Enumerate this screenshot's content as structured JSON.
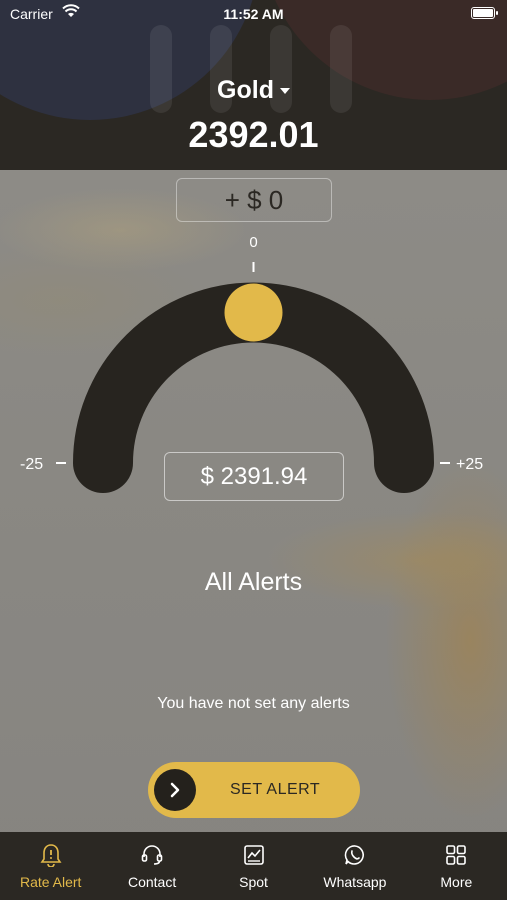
{
  "status_bar": {
    "carrier": "Carrier",
    "time": "11:52 AM"
  },
  "header": {
    "metal": "Gold",
    "price": "2392.01"
  },
  "dial": {
    "offset": "+ $ 0",
    "center_label": "0",
    "min_label": "-25",
    "max_label": "+25",
    "target_price": "$ 2391.94",
    "position_fraction": 0.5
  },
  "alerts": {
    "title": "All Alerts",
    "empty_message": "You have not set any alerts"
  },
  "set_alert": {
    "label": "SET ALERT"
  },
  "tabs": [
    {
      "label": "Rate Alert",
      "icon": "bell-icon",
      "active": true
    },
    {
      "label": "Contact",
      "icon": "headset-icon",
      "active": false
    },
    {
      "label": "Spot",
      "icon": "chart-icon",
      "active": false
    },
    {
      "label": "Whatsapp",
      "icon": "whatsapp-icon",
      "active": false
    },
    {
      "label": "More",
      "icon": "grid-icon",
      "active": false
    }
  ],
  "colors": {
    "accent": "#e2b94a",
    "dark": "#2b2823"
  }
}
